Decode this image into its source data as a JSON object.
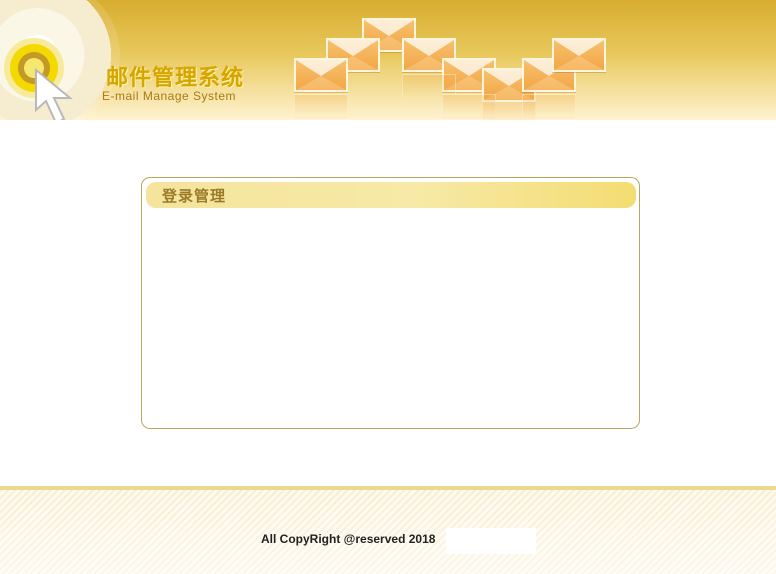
{
  "header": {
    "title_cn": "邮件管理系统",
    "title_en": "E-mail Manage System",
    "icons": {
      "logo": "target-logo-icon",
      "cursor": "cursor-pointer-icon",
      "mail": "mail-envelope-icon"
    }
  },
  "panel": {
    "title": "登录管理"
  },
  "footer": {
    "copyright": "All CopyRight @reserved  2018"
  },
  "colors": {
    "header_gold": "#d8ad2f",
    "envelope_orange": "#f3a646",
    "panel_border": "#b9a65b",
    "panel_header": "#f4e49c",
    "footer_stripe": "#f6eed0"
  }
}
